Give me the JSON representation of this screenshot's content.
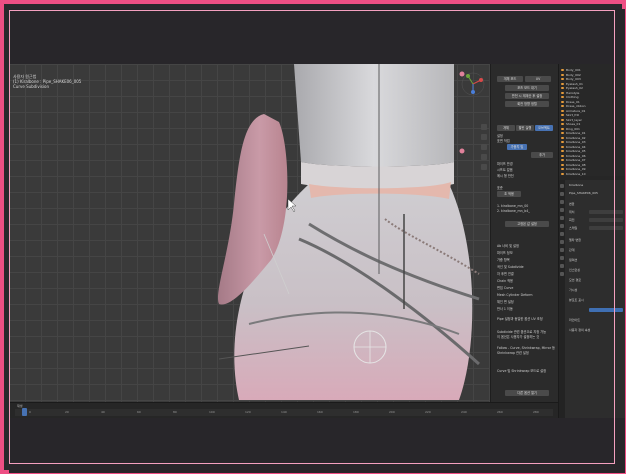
{
  "viewport": {
    "header": "사용자 원근법",
    "info_line1": "(1) Kiralbone : Pipe_SHAKE06_005",
    "info_line2": "Curve Subdivision"
  },
  "side_panel": {
    "row1_btn1": "개체 모드",
    "row1_btn2": "UV",
    "row2_btn": "포즈 모드 대기",
    "row3_btn": "반전 시 재계산 후 설정",
    "row4_btn": "회전 방향 정렬",
    "tabs": [
      "개체",
      "팔린 실행",
      "오브젝트"
    ],
    "label_settings": "설정",
    "label_mode": "표면 작업",
    "label_weight": "가중치 및",
    "btn_add": "추가",
    "label_value": "파이프 반경",
    "label_shift": "시프트 없음",
    "label_blend": "메시 형 반전",
    "label_toggle": "표준",
    "label_vertex_a": "1. kiralbone_mn_00",
    "label_vertex_b": "2. kiralbone_mn_b4_",
    "btn_apply": "초 적용",
    "btn_reset": "고정된 값 설정",
    "sections": [
      "Ab 너비 및 설정",
      "파이프 정보",
      "가중 항목",
      "곡선 및 Subdivide",
      "자 후면 연결",
      "Chain 적용",
      "편집 Curve",
      "Mesh Cylinder Deform",
      "체인 편 설정",
      "반사 1 이동"
    ],
    "info_block": "Pipe 설정과 동일한 옵션 UV 조정",
    "note1": "Subdivide 관련 옵션으로 지정 가능",
    "note2": "이 옵션은 사용자가 설정하는 것",
    "note3": "Follow - Curve, Shrinkwrap, Mirror 등",
    "note4": "Shrinkwrap 관련 설정",
    "note5": "Curve 및 Shrinkwrap 모드로 설정",
    "footer_btn": "다른 옵션 열기"
  },
  "outliner": {
    "items": [
      "Body_001",
      "Body_002",
      "Body_003",
      "Eyelash_01",
      "Eyelash_02",
      "Hairstyle",
      "Clothing",
      "Dress_01",
      "Dress_ribbon",
      "Armature_01",
      "Skirt_frill",
      "Skirt_layer",
      "Shoes_01",
      "Ring_001",
      "Kiralbone_01",
      "Kiralbone_02",
      "Kiralbone_03",
      "Kiralbone_04",
      "Kiralbone_05",
      "Kiralbone_06",
      "Kiralbone_07",
      "Kiralbone_08",
      "Kiralbone_09",
      "Kiralbone_10"
    ]
  },
  "properties": {
    "header": "Kiralbone",
    "object_name": "Pipe_SHAKE06_005",
    "lines": [
      "변환",
      "위치",
      "회전",
      "스케일",
      "델타 변환",
      "관계",
      "컬렉션",
      "인스턴싱",
      "모션 경로",
      "가시성",
      "뷰포트 표시",
      "라인아트",
      "사용자 정의 속성"
    ]
  },
  "timeline": {
    "label": "재생",
    "numbers": [
      "0",
      "20",
      "40",
      "60",
      "80",
      "100",
      "120",
      "140",
      "160",
      "180",
      "200",
      "220",
      "240",
      "260",
      "280"
    ]
  },
  "colors": {
    "frame_pink": "#ee4f84",
    "accent_blue": "#4772b3",
    "outliner_orange": "#e39a3b"
  }
}
